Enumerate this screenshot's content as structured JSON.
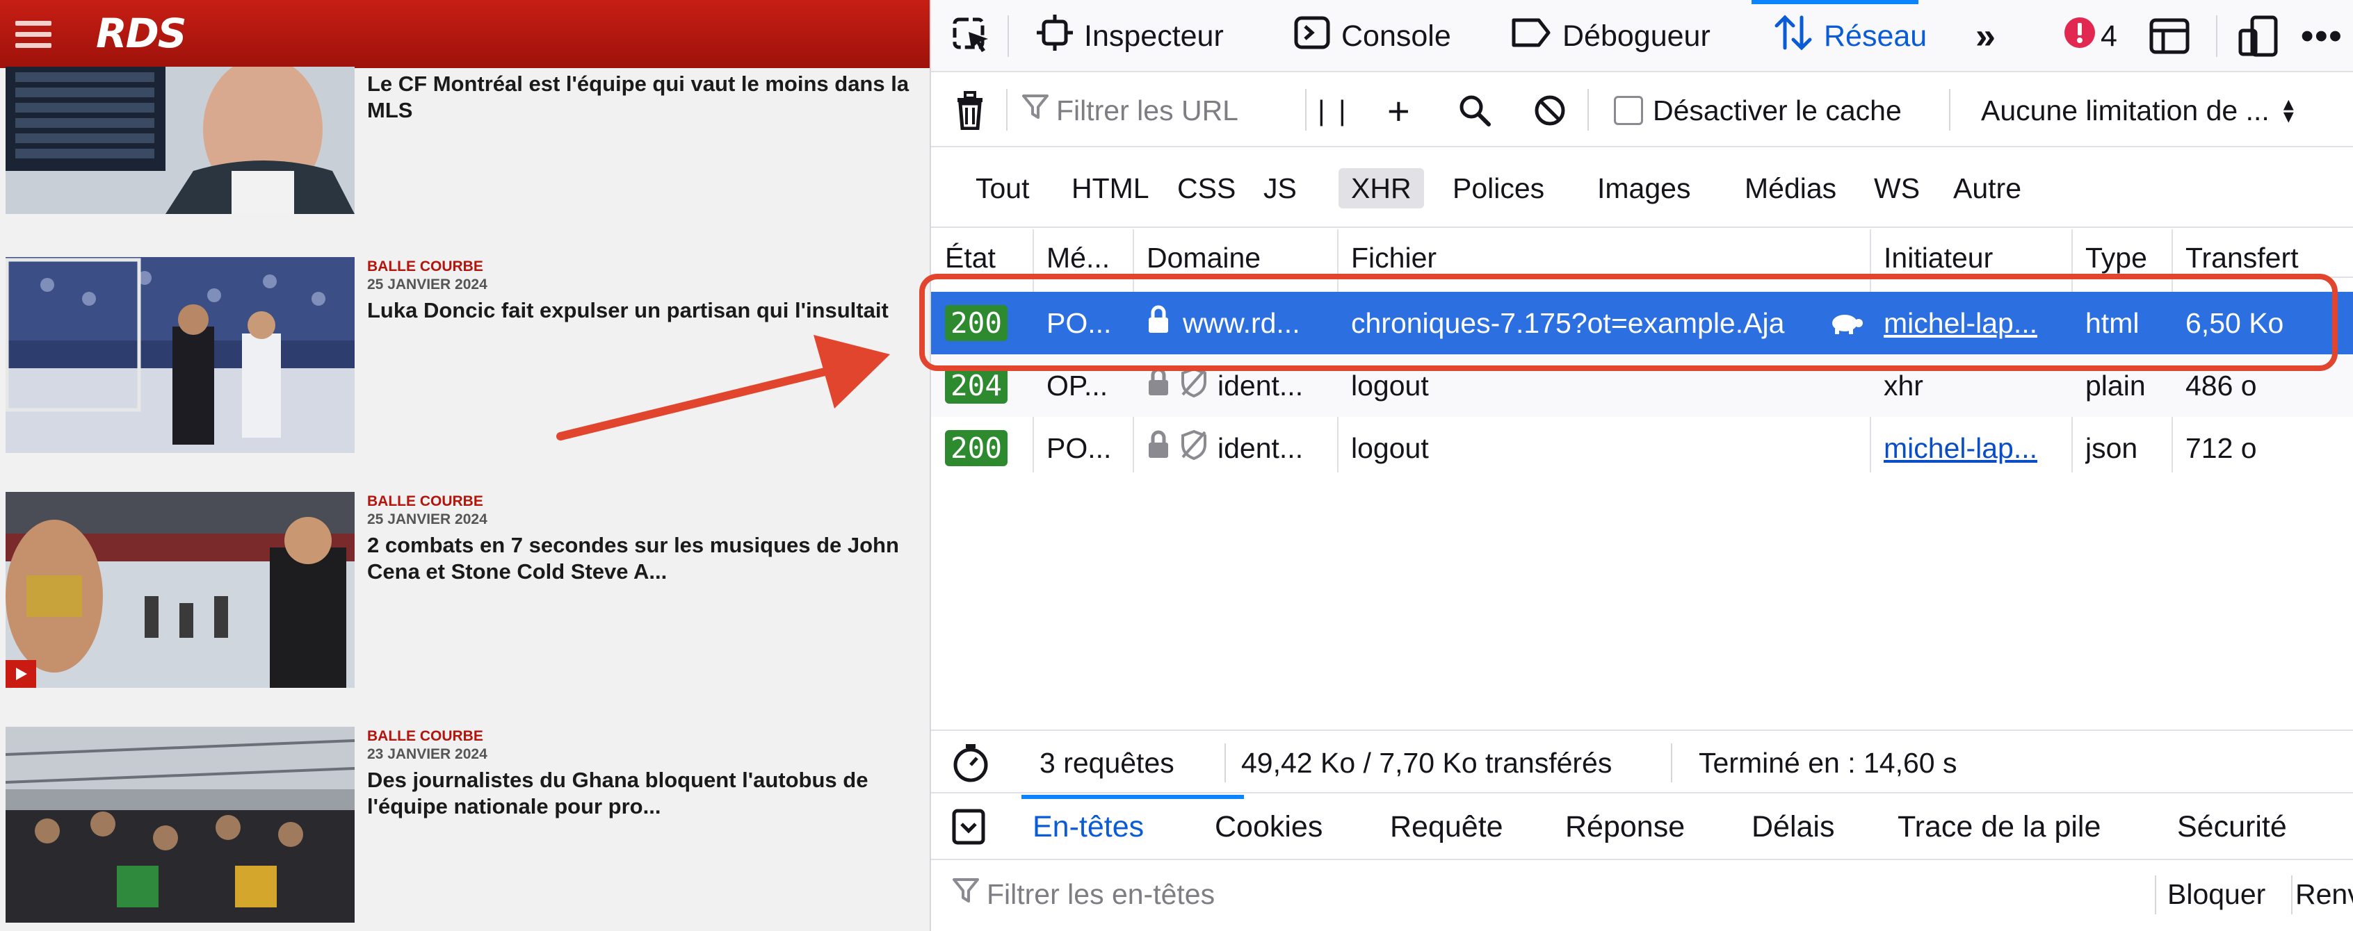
{
  "site": {
    "logo": "RDS",
    "articles": [
      {
        "category": "",
        "date": "",
        "title": "Le CF Montréal est l'équipe qui vaut le moins dans la MLS",
        "video": false
      },
      {
        "category": "BALLE COURBE",
        "date": "25 JANVIER 2024",
        "title": "Luka Doncic fait expulser un partisan qui l'insultait",
        "video": false
      },
      {
        "category": "BALLE COURBE",
        "date": "25 JANVIER 2024",
        "title": "2 combats en 7 secondes sur les musiques de John Cena et Stone Cold Steve A...",
        "video": true
      },
      {
        "category": "BALLE COURBE",
        "date": "23 JANVIER 2024",
        "title": "Des journalistes du Ghana bloquent l'autobus de l'équipe nationale pour pro...",
        "video": false
      }
    ]
  },
  "devtools": {
    "tabs": [
      "Inspecteur",
      "Console",
      "Débogueur",
      "Réseau"
    ],
    "selected_tab": "Réseau",
    "error_count": "4",
    "toolbar": {
      "filter_placeholder": "Filtrer les URL",
      "pause_label": "| |",
      "disable_cache": "Désactiver le cache",
      "throttling": "Aucune limitation de ..."
    },
    "type_filters": [
      "Tout",
      "HTML",
      "CSS",
      "JS",
      "XHR",
      "Polices",
      "Images",
      "Médias",
      "WS",
      "Autre"
    ],
    "active_filter": "XHR",
    "columns": [
      "État",
      "Mé...",
      "Domaine",
      "Fichier",
      "Initiateur",
      "Type",
      "Transfert"
    ],
    "requests": [
      {
        "status": "200",
        "method": "PO...",
        "domain": "www.rd...",
        "file": "chroniques-7.175?ot=example.Aja",
        "initiator": "michel-lap...",
        "type": "html",
        "transfer": "6,50 Ko",
        "selected": true,
        "tracker": false
      },
      {
        "status": "204",
        "method": "OP...",
        "domain": "ident...",
        "file": "logout",
        "initiator": "xhr",
        "type": "plain",
        "transfer": "486 o",
        "selected": false,
        "tracker": true
      },
      {
        "status": "200",
        "method": "PO...",
        "domain": "ident...",
        "file": "logout",
        "initiator": "michel-lap...",
        "type": "json",
        "transfer": "712 o",
        "selected": false,
        "tracker": true
      }
    ],
    "summary": {
      "requests": "3 requêtes",
      "size": "49,42 Ko / 7,70 Ko transférés",
      "finished": "Terminé en : 14,60 s"
    },
    "detail_tabs": [
      "En-têtes",
      "Cookies",
      "Requête",
      "Réponse",
      "Délais",
      "Trace de la pile",
      "Sécurité"
    ],
    "active_detail_tab": "En-têtes",
    "headers_filter_placeholder": "Filtrer les en-têtes",
    "block_label": "Bloquer",
    "resend_label": "Renv"
  }
}
